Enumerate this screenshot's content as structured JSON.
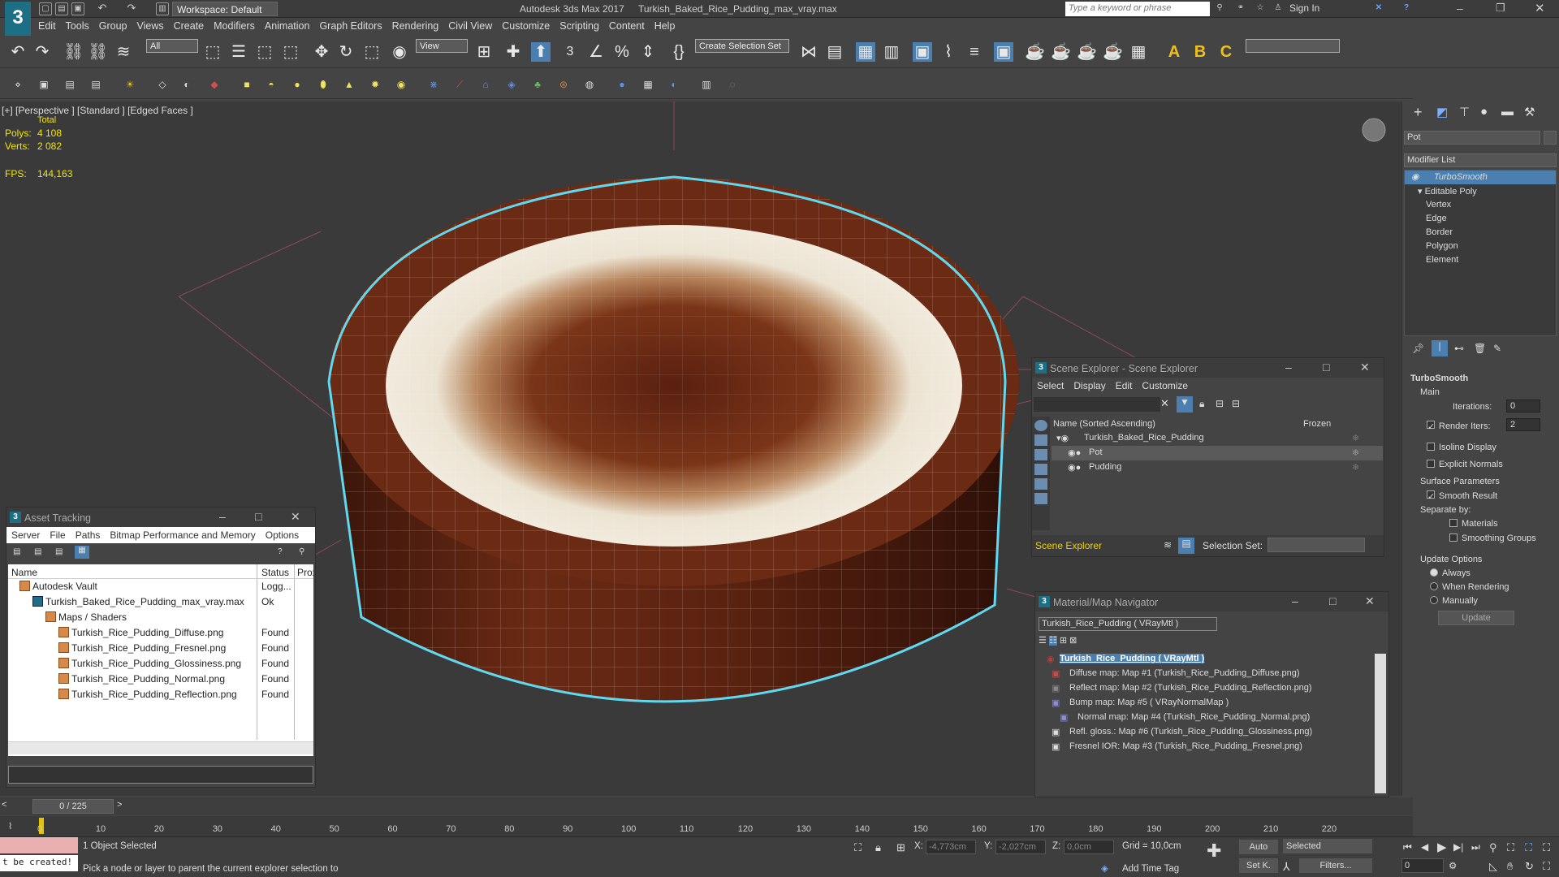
{
  "app": {
    "title": "Autodesk 3ds Max 2017",
    "file": "Turkish_Baked_Rice_Pudding_max_vray.max",
    "workspace": "Workspace: Default",
    "search_placeholder": "Type a keyword or phrase",
    "sign_in": "Sign In",
    "logo": "3"
  },
  "menu": [
    "Edit",
    "Tools",
    "Group",
    "Views",
    "Create",
    "Modifiers",
    "Animation",
    "Graph Editors",
    "Rendering",
    "Civil View",
    "Customize",
    "Scripting",
    "Content",
    "Help"
  ],
  "toolbar": {
    "filter": "All",
    "view": "View",
    "selection_set": "Create Selection Set"
  },
  "viewport": {
    "label": "[+] [Perspective ] [Standard ] [Edged Faces ]",
    "total": "Total",
    "polys_label": "Polys:",
    "polys_value": "4 108",
    "verts_label": "Verts:",
    "verts_value": "2 082",
    "fps_label": "FPS:",
    "fps_value": "144,163"
  },
  "asset_tracking": {
    "title": "Asset Tracking",
    "menu": [
      "Server",
      "File",
      "Paths",
      "Bitmap Performance and Memory",
      "Options"
    ],
    "col_name": "Name",
    "col_status": "Status",
    "col_prox": "Prox",
    "rows": [
      {
        "name": "Autodesk Vault",
        "status": "Logg..."
      },
      {
        "name": "Turkish_Baked_Rice_Pudding_max_vray.max",
        "status": "Ok"
      },
      {
        "name": "Maps / Shaders",
        "status": ""
      },
      {
        "name": "Turkish_Rice_Pudding_Diffuse.png",
        "status": "Found"
      },
      {
        "name": "Turkish_Rice_Pudding_Fresnel.png",
        "status": "Found"
      },
      {
        "name": "Turkish_Rice_Pudding_Glossiness.png",
        "status": "Found"
      },
      {
        "name": "Turkish_Rice_Pudding_Normal.png",
        "status": "Found"
      },
      {
        "name": "Turkish_Rice_Pudding_Reflection.png",
        "status": "Found"
      }
    ]
  },
  "scene_explorer": {
    "title": "Scene Explorer - Scene Explorer",
    "menu": [
      "Select",
      "Display",
      "Edit",
      "Customize"
    ],
    "col_name": "Name (Sorted Ascending)",
    "col_frozen": "Frozen",
    "items": [
      "Turkish_Baked_Rice_Pudding",
      "Pot",
      "Pudding"
    ],
    "footer_name": "Scene Explorer",
    "selection_set_label": "Selection Set:"
  },
  "material_nav": {
    "title": "Material/Map Navigator",
    "field": "Turkish_Rice_Pudding  ( VRayMtl )",
    "items": [
      "Turkish_Rice_Pudding  ( VRayMtl )",
      "Diffuse map: Map #1 (Turkish_Rice_Pudding_Diffuse.png)",
      "Reflect map: Map #2 (Turkish_Rice_Pudding_Reflection.png)",
      "Bump map: Map #5  ( VRayNormalMap )",
      "Normal map: Map #4 (Turkish_Rice_Pudding_Normal.png)",
      "Refl. gloss.: Map #6 (Turkish_Rice_Pudding_Glossiness.png)",
      "Fresnel IOR: Map #3 (Turkish_Rice_Pudding_Fresnel.png)"
    ]
  },
  "command_panel": {
    "object_name": "Pot",
    "modifier_list": "Modifier List",
    "stack": [
      "TurboSmooth",
      "Editable Poly",
      "Vertex",
      "Edge",
      "Border",
      "Polygon",
      "Element"
    ],
    "rollout_title": "TurboSmooth",
    "main": "Main",
    "iterations_label": "Iterations:",
    "iterations_value": "0",
    "render_iters_label": "Render Iters:",
    "render_iters_value": "2",
    "isoline": "Isoline Display",
    "explicit": "Explicit Normals",
    "surface_params": "Surface Parameters",
    "smooth_result": "Smooth Result",
    "separate_by": "Separate by:",
    "materials": "Materials",
    "smoothing_groups": "Smoothing Groups",
    "update_options": "Update Options",
    "always": "Always",
    "when_rendering": "When Rendering",
    "manually": "Manually",
    "update_btn": "Update"
  },
  "timeline": {
    "frame": "0 / 225",
    "ticks": [
      "0",
      "10",
      "20",
      "30",
      "40",
      "50",
      "60",
      "70",
      "80",
      "90",
      "100",
      "110",
      "120",
      "130",
      "140",
      "150",
      "160",
      "170",
      "180",
      "190",
      "200",
      "210",
      "220"
    ]
  },
  "status": {
    "script": "t be created!",
    "selected": "1 Object Selected",
    "prompt": "Pick a node or layer to parent the current explorer selection to",
    "x_label": "X:",
    "x_value": "-4,773cm",
    "y_label": "Y:",
    "y_value": "-2,027cm",
    "z_label": "Z:",
    "z_value": "0,0cm",
    "grid": "Grid = 10,0cm",
    "add_time_tag": "Add Time Tag",
    "auto": "Auto",
    "set_k": "Set K.",
    "selected_dd": "Selected",
    "filters": "Filters...",
    "frame_value": "0"
  }
}
